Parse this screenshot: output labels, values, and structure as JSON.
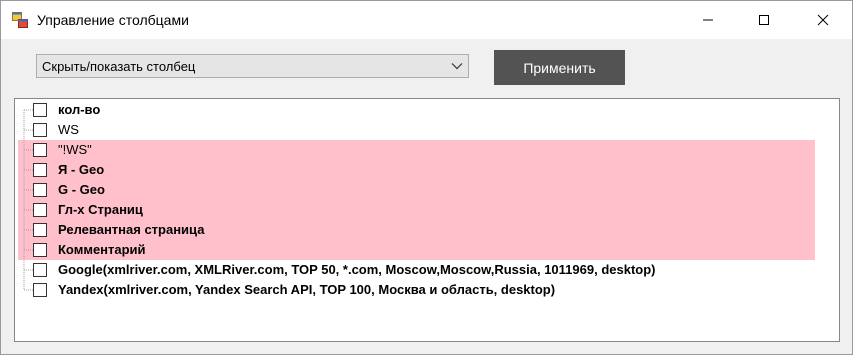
{
  "window": {
    "title": "Управление столбцами",
    "icons": {
      "app": "app-window-icon",
      "minimize": "minimize-icon",
      "maximize": "maximize-icon",
      "close": "close-icon"
    }
  },
  "toolbar": {
    "mode_select": {
      "value": "Скрыть/показать столбец",
      "icon": "chevron-down-icon"
    },
    "apply_label": "Применить",
    "apply_bg": "#535353"
  },
  "tree": {
    "highlight_color": "#ffc0cb",
    "items": [
      {
        "label": "кол-во",
        "bold": true,
        "checked": false,
        "highlighted": false
      },
      {
        "label": "WS",
        "bold": false,
        "checked": false,
        "highlighted": false
      },
      {
        "label": "\"!WS\"",
        "bold": false,
        "checked": false,
        "highlighted": true
      },
      {
        "label": "Я - Geo",
        "bold": true,
        "checked": false,
        "highlighted": true
      },
      {
        "label": "G - Geo",
        "bold": true,
        "checked": false,
        "highlighted": true
      },
      {
        "label": "Гл-х Страниц",
        "bold": true,
        "checked": false,
        "highlighted": true
      },
      {
        "label": "Релевантная страница",
        "bold": true,
        "checked": false,
        "highlighted": true
      },
      {
        "label": "Комментарий",
        "bold": true,
        "checked": false,
        "highlighted": true
      },
      {
        "label": "Google(xmlriver.com, XMLRiver.com, TOP 50, *.com, Moscow,Moscow,Russia, 1011969, desktop)",
        "bold": true,
        "checked": false,
        "highlighted": false
      },
      {
        "label": "Yandex(xmlriver.com, Yandex Search API, TOP 100, Москва и область, desktop)",
        "bold": true,
        "checked": false,
        "highlighted": false
      }
    ]
  }
}
